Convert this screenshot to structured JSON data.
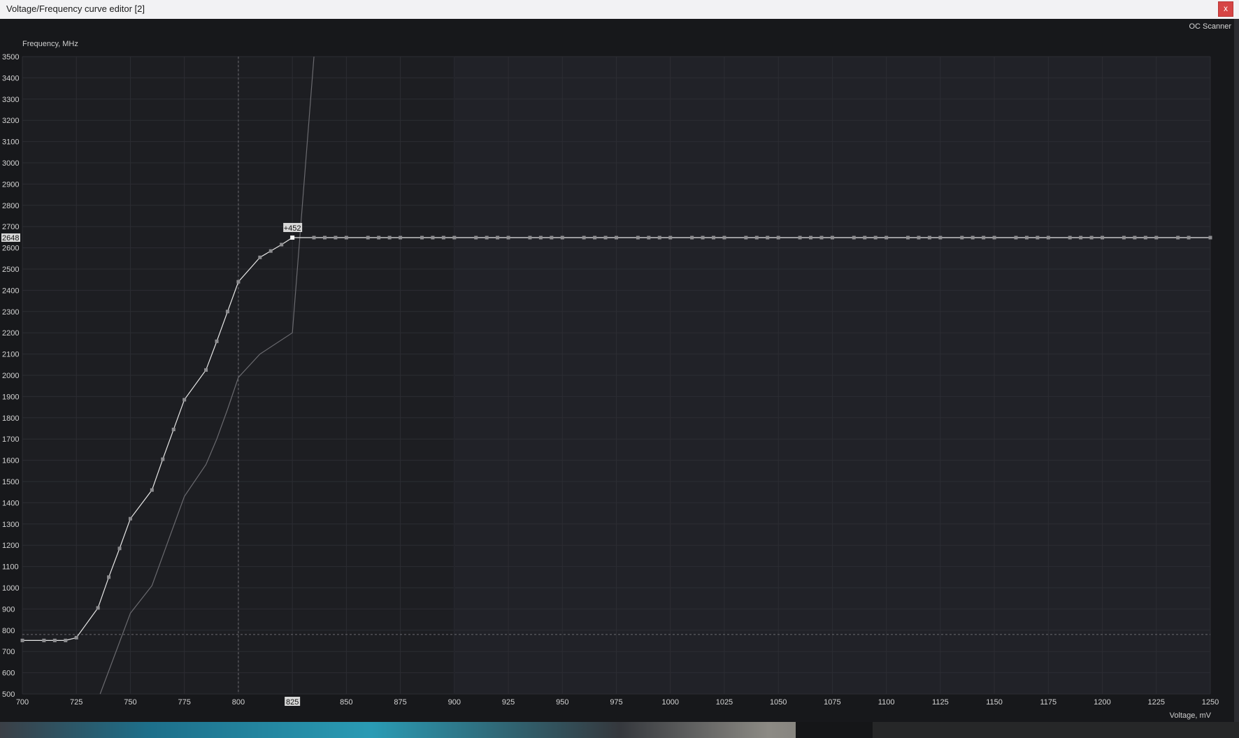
{
  "window": {
    "title": "Voltage/Frequency curve editor [2]",
    "close_label": "x"
  },
  "toolbar": {
    "oc_scanner_label": "OC Scanner"
  },
  "colors": {
    "background": "#17181b",
    "plot_left": "#1d1e22",
    "plot_right": "#212228",
    "grid": "#2c2d33",
    "curve": "#e6e6e6",
    "reference_curve": "#6a6a6f",
    "point": "#8d8d90",
    "highlight_point": "#f4f4f4",
    "label_bg": "#d8d8d8"
  },
  "chart_data": {
    "type": "line",
    "xlabel": "Voltage, mV",
    "ylabel": "Frequency, MHz",
    "xlim": [
      700,
      1250
    ],
    "ylim": [
      500,
      3500
    ],
    "x_ticks": [
      700,
      725,
      750,
      775,
      800,
      825,
      850,
      875,
      900,
      925,
      950,
      975,
      1000,
      1025,
      1050,
      1075,
      1100,
      1125,
      1150,
      1175,
      1200,
      1225,
      1250
    ],
    "y_ticks": [
      500,
      600,
      700,
      800,
      900,
      1000,
      1100,
      1200,
      1300,
      1400,
      1500,
      1600,
      1700,
      1800,
      1900,
      2000,
      2100,
      2200,
      2300,
      2400,
      2500,
      2600,
      2700,
      2800,
      2900,
      3000,
      3100,
      3200,
      3300,
      3400,
      3500
    ],
    "grid": true,
    "shaded_region_from_voltage": 900,
    "selected_voltage": 825,
    "selected_frequency": 2648,
    "selected_voltage_label": "825",
    "selected_frequency_label": "2648",
    "offset_label": "+452",
    "current_voltage_marker": 800,
    "current_frequency_marker": 780,
    "series": [
      {
        "style": "edited",
        "x": [
          700,
          710,
          715,
          720,
          725,
          735,
          740,
          745,
          750,
          760,
          765,
          770,
          775,
          785,
          790,
          795,
          800,
          810,
          815,
          820,
          825,
          835,
          840,
          845,
          850,
          860,
          865,
          870,
          875,
          885,
          890,
          895,
          900,
          910,
          915,
          920,
          925,
          935,
          940,
          945,
          950,
          960,
          965,
          970,
          975,
          985,
          990,
          995,
          1000,
          1010,
          1015,
          1020,
          1025,
          1035,
          1040,
          1045,
          1050,
          1060,
          1065,
          1070,
          1075,
          1085,
          1090,
          1095,
          1100,
          1110,
          1115,
          1120,
          1125,
          1135,
          1140,
          1145,
          1150,
          1160,
          1165,
          1170,
          1175,
          1185,
          1190,
          1195,
          1200,
          1210,
          1215,
          1220,
          1225,
          1235,
          1240,
          1250
        ],
        "y": [
          752,
          752,
          752,
          752,
          765,
          905,
          1050,
          1185,
          1325,
          1460,
          1605,
          1745,
          1885,
          2025,
          2160,
          2300,
          2440,
          2555,
          2585,
          2615,
          2648,
          2648,
          2648,
          2648,
          2648,
          2648,
          2648,
          2648,
          2648,
          2648,
          2648,
          2648,
          2648,
          2648,
          2648,
          2648,
          2648,
          2648,
          2648,
          2648,
          2648,
          2648,
          2648,
          2648,
          2648,
          2648,
          2648,
          2648,
          2648,
          2648,
          2648,
          2648,
          2648,
          2648,
          2648,
          2648,
          2648,
          2648,
          2648,
          2648,
          2648,
          2648,
          2648,
          2648,
          2648,
          2648,
          2648,
          2648,
          2648,
          2648,
          2648,
          2648,
          2648,
          2648,
          2648,
          2648,
          2648,
          2648,
          2648,
          2648,
          2648,
          2648,
          2648,
          2648,
          2648,
          2648,
          2648,
          2648
        ]
      },
      {
        "style": "reference",
        "x": [
          736,
          750,
          760,
          775,
          785,
          790,
          795,
          800,
          810,
          825,
          835
        ],
        "y": [
          500,
          880,
          1010,
          1430,
          1580,
          1700,
          1840,
          1990,
          2100,
          2200,
          3500
        ]
      }
    ]
  }
}
